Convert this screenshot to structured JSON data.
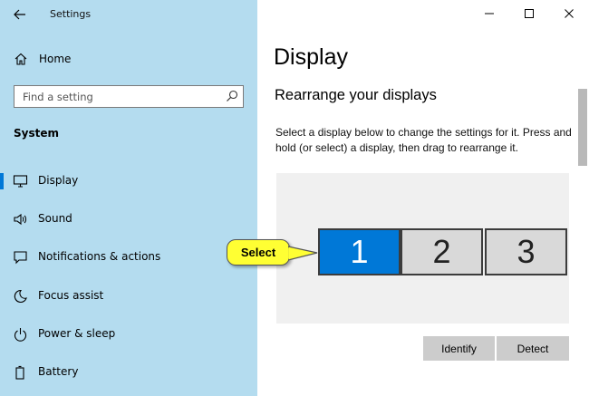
{
  "window": {
    "title": "Settings",
    "controls": [
      "minimize-icon",
      "maximize-icon",
      "close-icon"
    ]
  },
  "sidebar": {
    "home_label": "Home",
    "search": {
      "placeholder": "Find a setting"
    },
    "section_title": "System",
    "items": [
      {
        "label": "Display",
        "icon": "monitor-icon",
        "selected": true
      },
      {
        "label": "Sound",
        "icon": "speaker-icon"
      },
      {
        "label": "Notifications & actions",
        "icon": "notification-icon"
      },
      {
        "label": "Focus assist",
        "icon": "moon-icon"
      },
      {
        "label": "Power & sleep",
        "icon": "power-icon"
      },
      {
        "label": "Battery",
        "icon": "battery-icon"
      }
    ]
  },
  "main": {
    "title": "Display",
    "subheading": "Rearrange your displays",
    "instructions": "Select a display below to change the settings for it. Press and hold (or select) a display, then drag to rearrange it.",
    "monitors": [
      {
        "label": "1",
        "selected": true
      },
      {
        "label": "2",
        "selected": false
      },
      {
        "label": "3",
        "selected": false
      }
    ],
    "identify_label": "Identify",
    "detect_label": "Detect"
  },
  "callout": {
    "label": "Select"
  },
  "colors": {
    "sidebar_bg": "#b4dcef",
    "accent": "#0078d7",
    "callout_bg": "#ffff33"
  }
}
